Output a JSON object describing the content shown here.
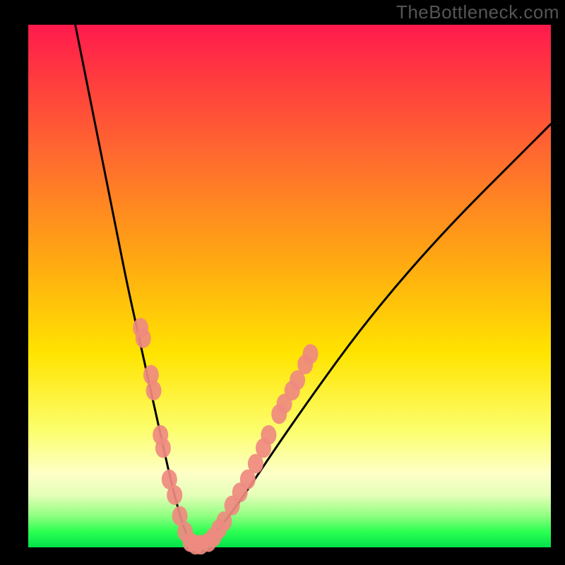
{
  "watermark": "TheBottleneck.com",
  "chart_data": {
    "type": "line",
    "title": "",
    "xlabel": "",
    "ylabel": "",
    "xlim": [
      0,
      100
    ],
    "ylim": [
      0,
      100
    ],
    "series": [
      {
        "name": "bottleneck-curve",
        "x": [
          9,
          11,
          13,
          15,
          17,
          19,
          21,
          23,
          25,
          27,
          28.5,
          30,
          31.5,
          33,
          37,
          42,
          48,
          55,
          63,
          72,
          82,
          93,
          100
        ],
        "y": [
          100,
          90,
          80,
          70,
          60,
          50,
          41,
          32,
          23,
          14,
          8,
          3,
          0.5,
          0.5,
          4,
          11,
          20,
          30,
          41,
          52,
          63,
          74,
          81
        ]
      }
    ],
    "markers": {
      "name": "highlight-points",
      "points": [
        [
          21.5,
          42
        ],
        [
          22,
          40
        ],
        [
          23.5,
          33
        ],
        [
          24,
          30
        ],
        [
          25.3,
          21.5
        ],
        [
          25.8,
          19
        ],
        [
          27,
          13
        ],
        [
          28,
          10
        ],
        [
          29,
          6
        ],
        [
          30,
          3
        ],
        [
          31,
          1
        ],
        [
          32,
          0.5
        ],
        [
          33,
          0.5
        ],
        [
          34.5,
          1
        ],
        [
          35.5,
          2
        ],
        [
          36.5,
          3.5
        ],
        [
          37.5,
          5
        ],
        [
          39,
          8
        ],
        [
          40.5,
          10.5
        ],
        [
          42,
          13
        ],
        [
          43.5,
          16
        ],
        [
          45,
          19
        ],
        [
          46,
          21.5
        ],
        [
          48,
          25.5
        ],
        [
          49,
          27.5
        ],
        [
          50.5,
          30
        ],
        [
          51.5,
          32
        ],
        [
          53,
          35
        ],
        [
          54,
          37
        ]
      ]
    },
    "gradient_stops": [
      {
        "pos": 0,
        "color": "#ff1a4d"
      },
      {
        "pos": 25,
        "color": "#ff6a2f"
      },
      {
        "pos": 63,
        "color": "#ffe400"
      },
      {
        "pos": 90,
        "color": "#e5ffb8"
      },
      {
        "pos": 100,
        "color": "#00e24a"
      }
    ]
  }
}
